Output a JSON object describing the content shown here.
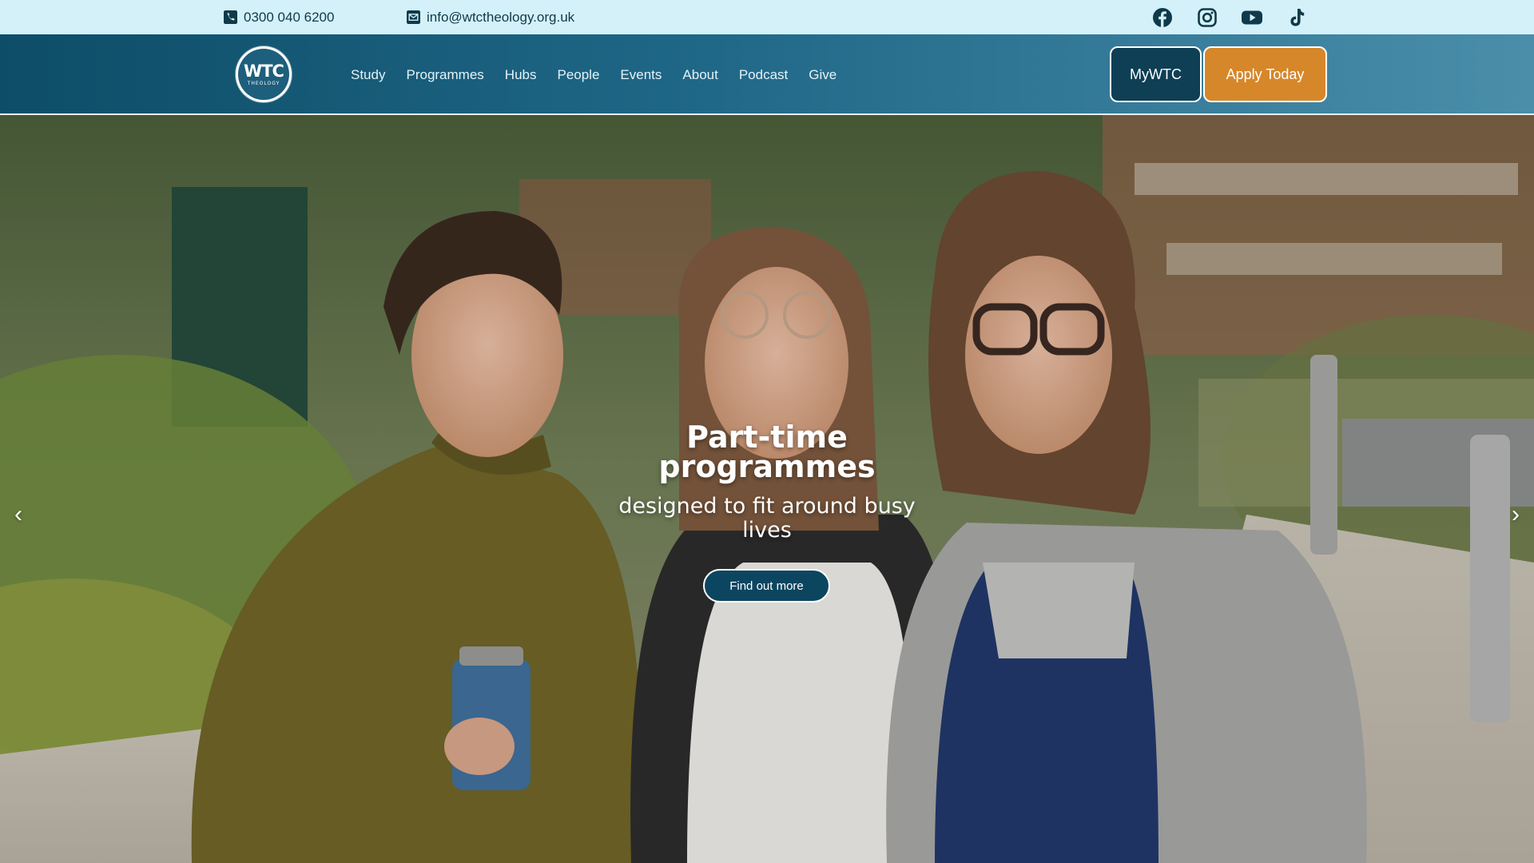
{
  "topbar": {
    "phone": "0300 040 6200",
    "email": "info@wtctheology.org.uk",
    "icons": {
      "phone": "phone-icon",
      "email": "envelope-icon"
    },
    "socials": [
      "facebook-icon",
      "instagram-icon",
      "youtube-icon",
      "tiktok-icon"
    ]
  },
  "nav": {
    "logo_text": "WTC",
    "logo_sub": "THEOLOGY",
    "links": [
      "Study",
      "Programmes",
      "Hubs",
      "People",
      "Events",
      "About",
      "Podcast",
      "Give"
    ],
    "mywtc_label": "MyWTC",
    "apply_label": "Apply Today"
  },
  "hero": {
    "title": "Part-time programmes",
    "subtitle": "designed to fit around busy lives",
    "cta_label": "Find out more",
    "prev_arrow": "‹",
    "next_arrow": "›"
  },
  "colors": {
    "topbar_bg": "#d4f1f9",
    "nav_dark": "#0d4d67",
    "nav_light": "#4a8eaa",
    "apply_orange": "#d6872a",
    "mywtc_bg": "#0e3f55",
    "cta_bg": "#0c4560"
  }
}
